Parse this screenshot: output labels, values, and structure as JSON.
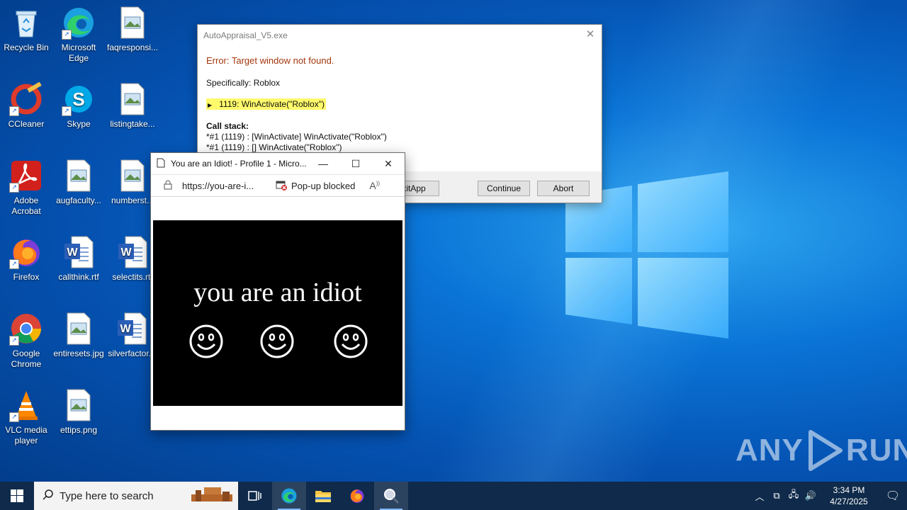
{
  "desktop": {
    "icons": [
      {
        "label": "Recycle Bin",
        "icon": "recycle-bin-icon"
      },
      {
        "label": "Microsoft Edge",
        "icon": "edge-icon"
      },
      {
        "label": "faqresponsi...",
        "icon": "image-file-icon"
      },
      {
        "label": "CCleaner",
        "icon": "ccleaner-icon"
      },
      {
        "label": "Skype",
        "icon": "skype-icon"
      },
      {
        "label": "listingtake...",
        "icon": "image-file-icon"
      },
      {
        "label": "Adobe Acrobat",
        "icon": "acrobat-icon"
      },
      {
        "label": "augfaculty...",
        "icon": "image-file-icon"
      },
      {
        "label": "numberst...",
        "icon": "image-file-icon"
      },
      {
        "label": "Firefox",
        "icon": "firefox-icon"
      },
      {
        "label": "callthink.rtf",
        "icon": "word-doc-icon"
      },
      {
        "label": "selectits.rtf",
        "icon": "word-doc-icon"
      },
      {
        "label": "Google Chrome",
        "icon": "chrome-icon"
      },
      {
        "label": "entiresets.jpg",
        "icon": "image-file-icon"
      },
      {
        "label": "silverfactor...",
        "icon": "word-doc-icon"
      },
      {
        "label": "VLC media player",
        "icon": "vlc-icon"
      },
      {
        "label": "ettips.png",
        "icon": "image-file-icon"
      }
    ]
  },
  "error_dialog": {
    "title": "AutoAppraisal_V5.exe",
    "error": "Error: Target window not found.",
    "specifically": "Specifically: Roblox",
    "line": "1119: WinActivate(\"Roblox\")",
    "call_stack_title": "Call stack:",
    "call_stack": [
      "*#1 (1119) : [WinActivate] WinActivate(\"Roblox\")",
      "*#1 (1119) : [] WinActivate(\"Roblox\")"
    ],
    "buttons": {
      "exitapp": "ExitApp",
      "continue": "Continue",
      "abort": "Abort"
    },
    "error_color": "#a3370d",
    "highlight_color": "#fffa6b"
  },
  "popup": {
    "title": "You are an Idiot! - Profile 1 - Micro...",
    "url": "https://you-are-i...",
    "popup_blocked": "Pop-up blocked",
    "content_text": "you are an idiot",
    "smiley_count": 3
  },
  "watermark": {
    "text_left": "ANY",
    "text_right": "RUN"
  },
  "taskbar": {
    "search_placeholder": "Type here to search",
    "items": [
      "task-view",
      "edge",
      "file-explorer",
      "firefox",
      "magnifier-app"
    ],
    "clock_time": "3:34 PM",
    "clock_date": "4/27/2025",
    "color": "#0f2a4a"
  }
}
